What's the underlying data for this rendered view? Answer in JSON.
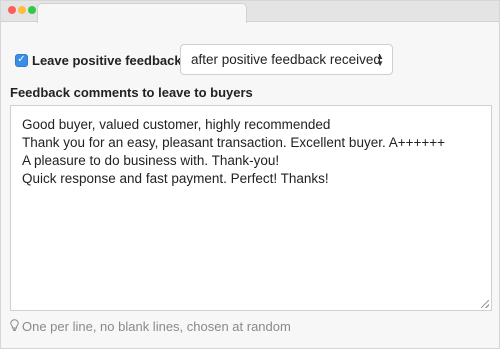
{
  "leave_feedback": {
    "checked": true,
    "label": "Leave positive feedback"
  },
  "trigger_select": {
    "selected": "after positive feedback received"
  },
  "comments": {
    "label": "Feedback comments to leave to buyers",
    "lines": [
      "Good buyer, valued customer, highly recommended",
      "Thank you for an easy, pleasant transaction. Excellent buyer. A++++++",
      "A pleasure to do business with. Thank-you!",
      "Quick response and fast payment. Perfect! Thanks!"
    ]
  },
  "hint": {
    "icon": "lightbulb-icon",
    "text": "One per line, no blank lines, chosen at random"
  },
  "colors": {
    "accent": "#3a8ee6"
  }
}
